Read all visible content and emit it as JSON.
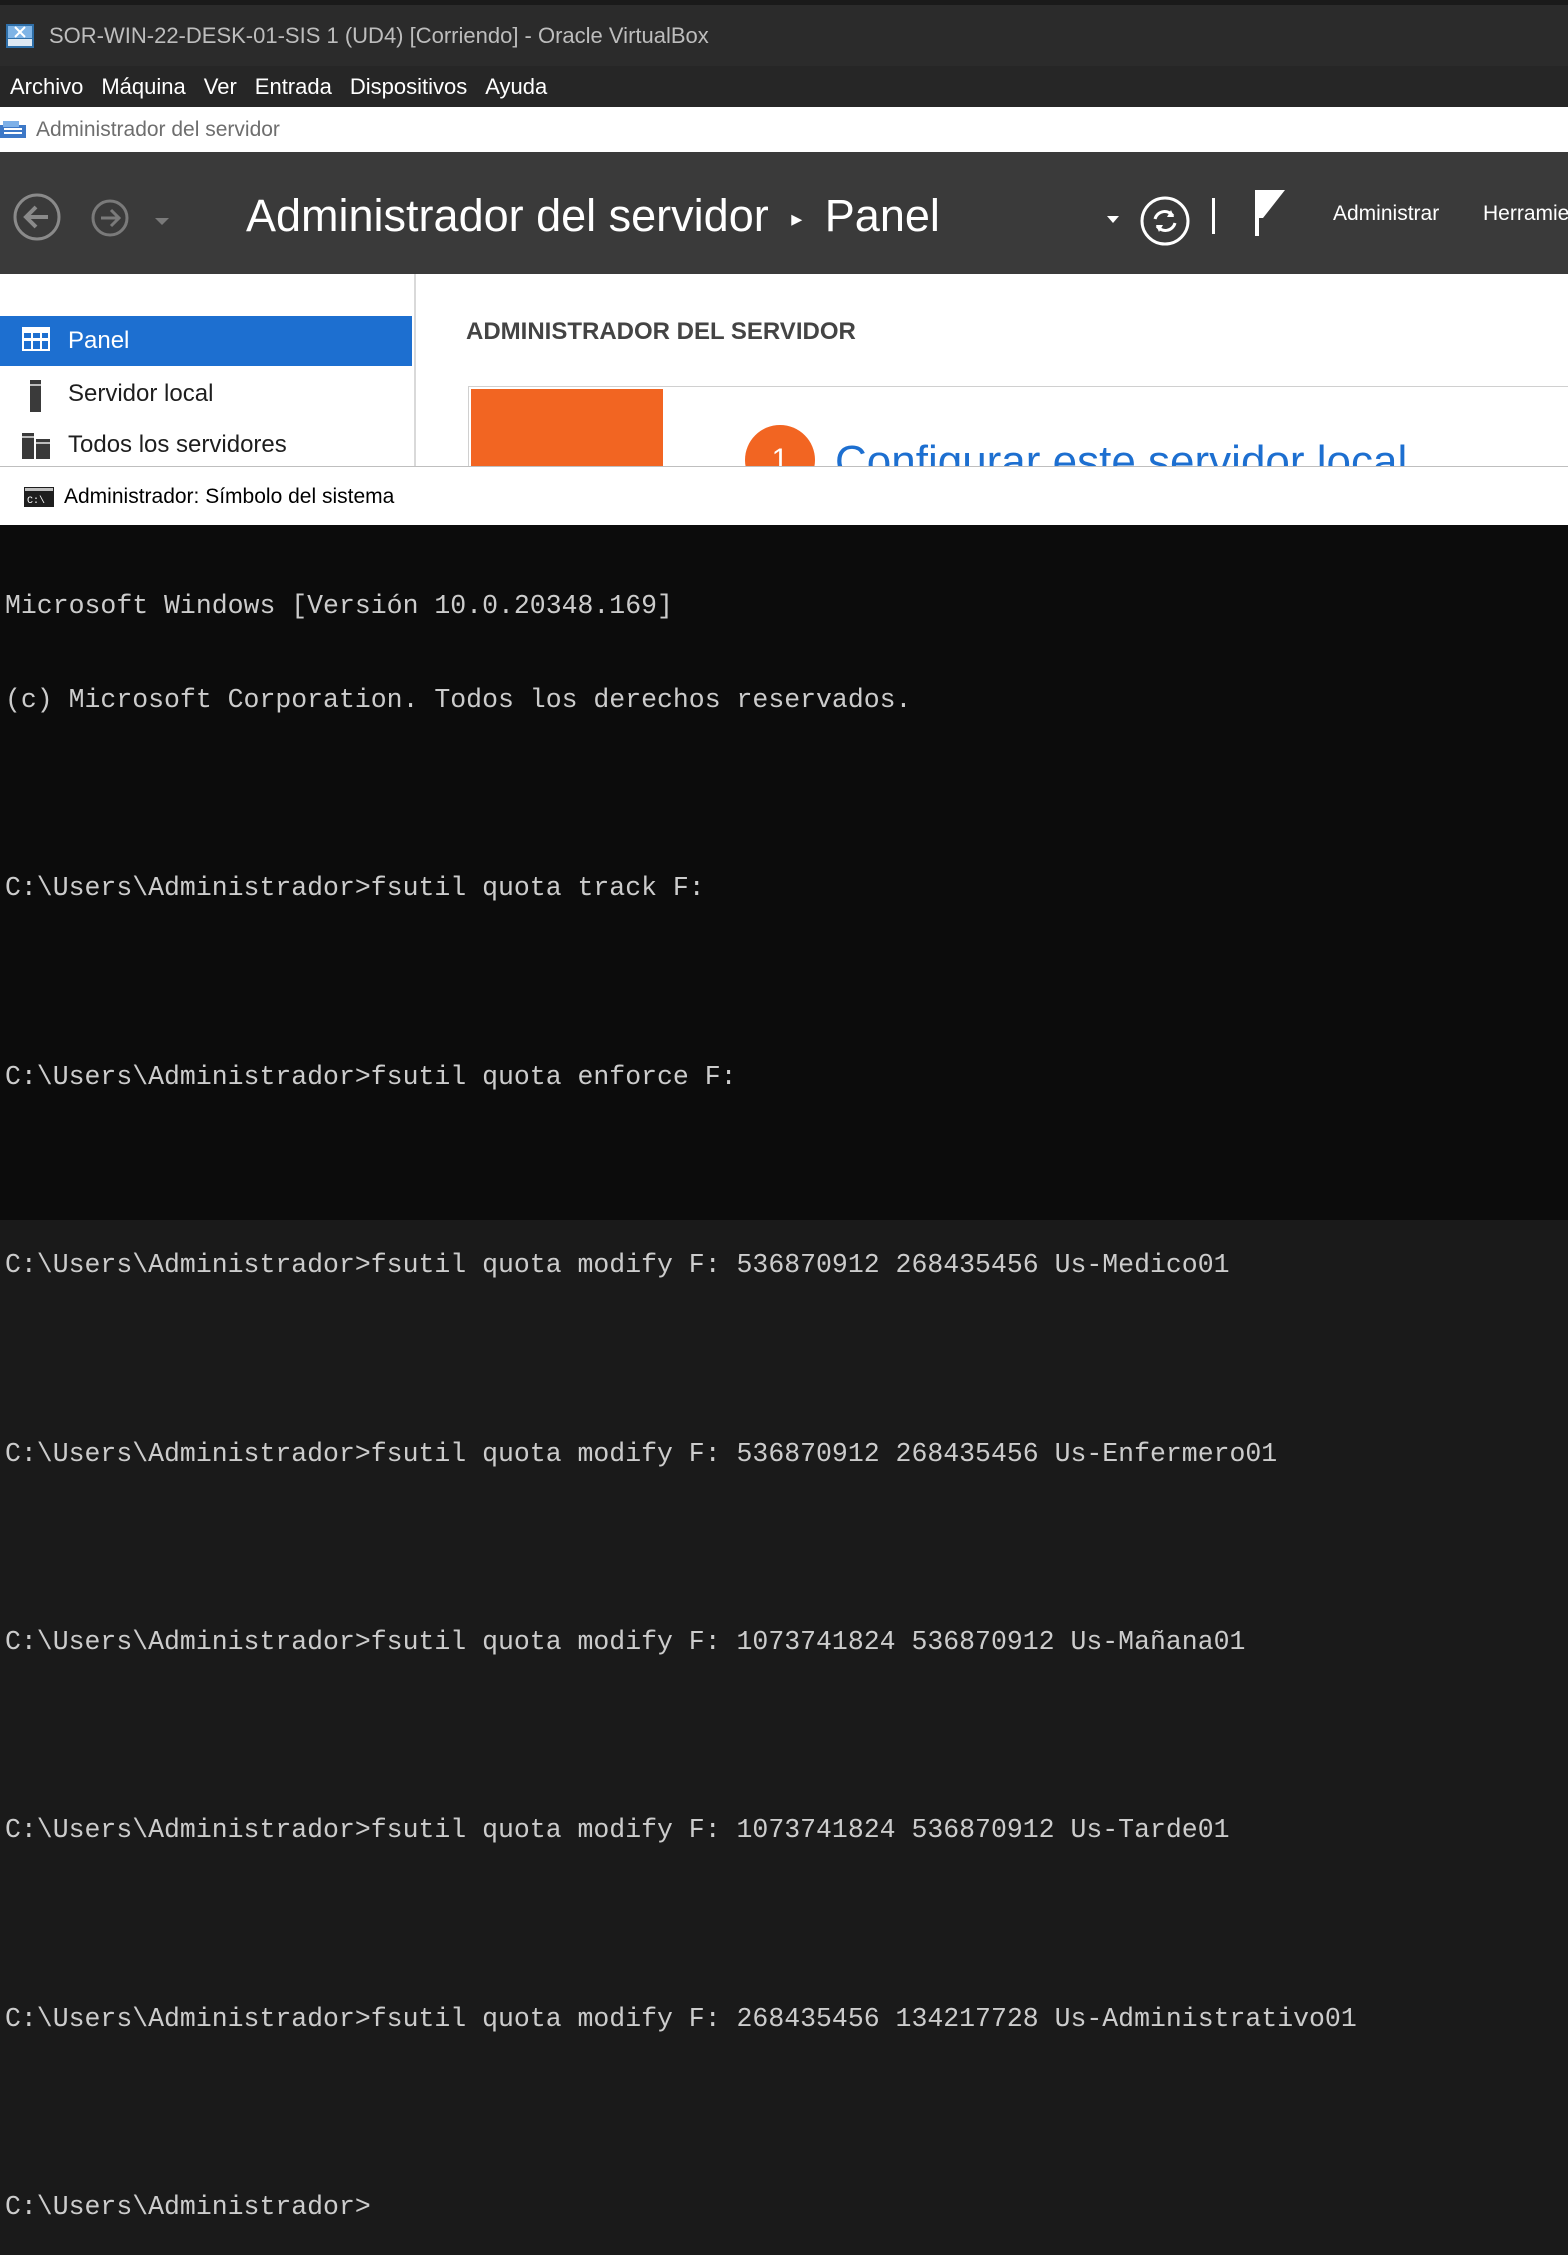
{
  "vbox": {
    "title": "SOR-WIN-22-DESK-01-SIS 1 (UD4) [Corriendo] - Oracle VirtualBox",
    "menu": [
      "Archivo",
      "Máquina",
      "Ver",
      "Entrada",
      "Dispositivos",
      "Ayuda"
    ]
  },
  "server_manager": {
    "window_title": "Administrador del servidor",
    "breadcrumb_app": "Administrador del servidor",
    "breadcrumb_sep": "▸",
    "breadcrumb_page": "Panel",
    "menu_manage": "Administrar",
    "menu_tools": "Herramientas",
    "sidebar": [
      {
        "label": "Panel",
        "active": true
      },
      {
        "label": "Servidor local",
        "active": false
      },
      {
        "label": "Todos los servidores",
        "active": false
      }
    ],
    "section_heading": "ADMINISTRADOR DEL SERVIDOR",
    "tile_step_number": "1",
    "tile_step_text": "Configurar este servidor local",
    "accent_orange": "#f26522",
    "accent_blue": "#1d6fd0"
  },
  "cmd": {
    "window_title": "Administrador: Símbolo del sistema",
    "lines": [
      "Microsoft Windows [Versión 10.0.20348.169]",
      "(c) Microsoft Corporation. Todos los derechos reservados.",
      "",
      "C:\\Users\\Administrador>fsutil quota track F:",
      "",
      "C:\\Users\\Administrador>fsutil quota enforce F:",
      "",
      "C:\\Users\\Administrador>fsutil quota modify F: 536870912 268435456 Us-Medico01",
      "",
      "C:\\Users\\Administrador>fsutil quota modify F: 536870912 268435456 Us-Enfermero01",
      "",
      "C:\\Users\\Administrador>fsutil quota modify F: 1073741824 536870912 Us-Mañana01",
      "",
      "C:\\Users\\Administrador>fsutil quota modify F: 1073741824 536870912 Us-Tarde01",
      "",
      "C:\\Users\\Administrador>fsutil quota modify F: 268435456 134217728 Us-Administrativo01",
      "",
      "C:\\Users\\Administrador>"
    ]
  }
}
